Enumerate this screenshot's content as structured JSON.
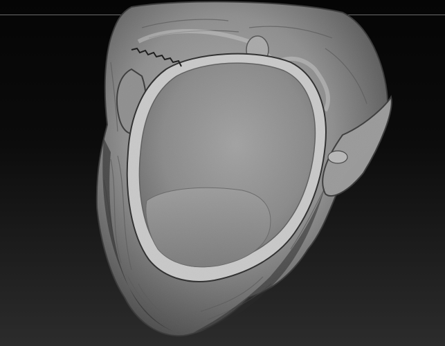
{
  "viewport": {
    "background_top": "#050505",
    "background_bottom": "#2c2c2c",
    "horizon_line_color": "#6c6c6c"
  },
  "model": {
    "icon": "sculpted-head-mesh-icon",
    "base_color": "#8e8e8e",
    "shadow_color": "#3f3f3f",
    "highlight_color": "#c4c4c4"
  }
}
